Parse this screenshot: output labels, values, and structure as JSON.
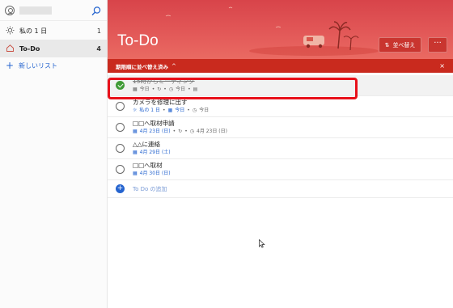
{
  "sidebar": {
    "items": [
      {
        "label": "私の 1 日",
        "count": "1",
        "icon": "sun-icon"
      },
      {
        "label": "To-Do",
        "count": "4",
        "icon": "home-icon"
      }
    ],
    "new_list": "新しいリスト"
  },
  "header": {
    "title": "To-Do",
    "sort_label": "並べ替え",
    "more_label": "···",
    "accent": "#d8444a"
  },
  "sortbar": {
    "label": "期限順に並べ替え済み",
    "chevron": "^",
    "close": "×"
  },
  "tasks": [
    {
      "title": "15時からミーティング",
      "done": true,
      "meta": [
        "今日",
        "•",
        "今日",
        "•"
      ]
    },
    {
      "title": "カメラを修理に出す",
      "done": false,
      "meta": [
        "私の 1 日",
        "•",
        "今日",
        "•",
        "今日"
      ]
    },
    {
      "title": "□□へ取材申請",
      "done": false,
      "meta": [
        "4月 23日 (日)",
        "•",
        "•",
        "4月 23日 (日)"
      ]
    },
    {
      "title": "△△に連絡",
      "done": false,
      "meta": [
        "4月 29日 (土)"
      ]
    },
    {
      "title": "□□へ取材",
      "done": false,
      "meta": [
        "4月 30日 (日)"
      ]
    }
  ],
  "add_task": "To Do の追加"
}
